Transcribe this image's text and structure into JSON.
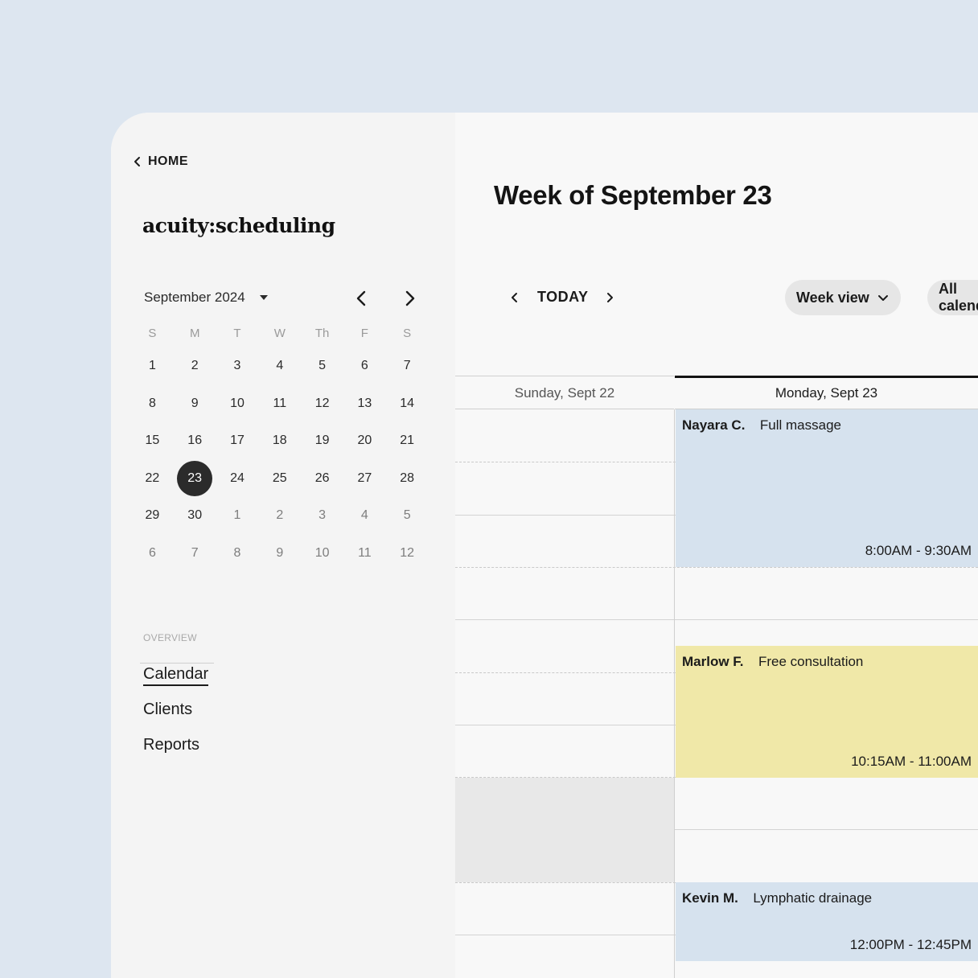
{
  "sidebar": {
    "home_label": "HOME",
    "logo": "acuity:scheduling",
    "month_label": "September 2024",
    "weekdays": [
      "S",
      "M",
      "T",
      "W",
      "Th",
      "F",
      "S"
    ],
    "weeks": [
      [
        "1",
        "2",
        "3",
        "4",
        "5",
        "6",
        "7"
      ],
      [
        "8",
        "9",
        "10",
        "11",
        "12",
        "13",
        "14"
      ],
      [
        "15",
        "16",
        "17",
        "18",
        "19",
        "20",
        "21"
      ],
      [
        "22",
        "23",
        "24",
        "25",
        "26",
        "27",
        "28"
      ],
      [
        "29",
        "30",
        "1",
        "2",
        "3",
        "4",
        "5"
      ],
      [
        "6",
        "7",
        "8",
        "9",
        "10",
        "11",
        "12"
      ]
    ],
    "selected_day": "23",
    "overview_label": "OVERVIEW",
    "nav": [
      {
        "label": "Calendar",
        "active": true
      },
      {
        "label": "Clients",
        "active": false
      },
      {
        "label": "Reports",
        "active": false
      }
    ]
  },
  "main": {
    "title": "Week of September 23",
    "today_label": "TODAY",
    "view_label": "Week view",
    "calendars_label": "All calendars",
    "days": [
      {
        "label": "Sunday, Sept 22"
      },
      {
        "label": "Monday, Sept 23"
      }
    ],
    "appointments": [
      {
        "client": "Nayara C.",
        "service": "Full massage",
        "time": "8:00AM - 9:30AM",
        "color": "#d6e2ee"
      },
      {
        "client": "Marlow F.",
        "service": "Free consultation",
        "time": "10:15AM - 11:00AM",
        "color": "#f0e8a8"
      },
      {
        "client": "Kevin M.",
        "service": "Lymphatic drainage",
        "time": "12:00PM - 12:45PM",
        "color": "#d6e2ee"
      }
    ]
  },
  "colors": {
    "page_bg": "#dde6f0",
    "accent_dark": "#2b2b2b",
    "appointment_blue": "#d6e2ee",
    "appointment_yellow": "#f0e8a8",
    "blocked_gray": "#e8e8e8"
  },
  "icons": {
    "home": "chevron-left-icon",
    "month_prev": "chevron-left-icon",
    "month_next": "chevron-right-icon",
    "dropdown": "chevron-down-icon"
  }
}
